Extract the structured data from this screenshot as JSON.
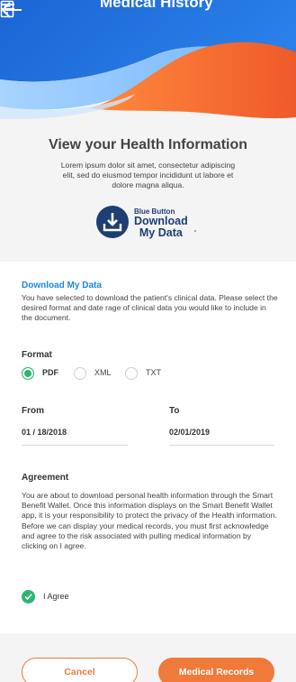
{
  "header": {
    "title": "Medical History",
    "back_icon": "arrow-left-icon",
    "title_icon": "document-icon",
    "menu_icon": "menu-icon"
  },
  "intro": {
    "heading": "View your Health Information",
    "body": "Lorem ipsum dolor sit amet, consectetur adipiscing elit, sed do eiusmod tempor incididunt ut labore et dolore magna aliqua.",
    "badge": {
      "small": "Blue Button",
      "line1": "Download",
      "line2": "My Data"
    }
  },
  "download": {
    "title": "Download My Data",
    "description": "You have selected to download the patient's clinical data. Please select the desired format and date rage of clinical data you would like to include in the document."
  },
  "format": {
    "label": "Format",
    "options": [
      "PDF",
      "XML",
      "TXT"
    ],
    "selected": "PDF"
  },
  "dates": {
    "from_label": "From",
    "from_value": "01 / 18/2018",
    "to_label": "To",
    "to_value": "02/01/2019"
  },
  "agreement": {
    "label": "Agreement",
    "text": "You are about to download personal health information through the Smart Benefit Wallet.  Once this information displays on the Smart Benefit Wallet app, it is your responsibility to protect the privacy of the Health information. Before we can display your medical records, you must first acknowledge and agree to the risk associated with pulling medical information by clicking on I agree.",
    "checkbox_label": "I Agree",
    "checked": true
  },
  "buttons": {
    "cancel": "Cancel",
    "records": "Medical Records"
  },
  "colors": {
    "header_blue": "#1f6fd6",
    "accent_orange": "#f07a3a",
    "link_blue": "#1e88d8",
    "success_green": "#2bb673",
    "badge_navy": "#1d3f73"
  }
}
